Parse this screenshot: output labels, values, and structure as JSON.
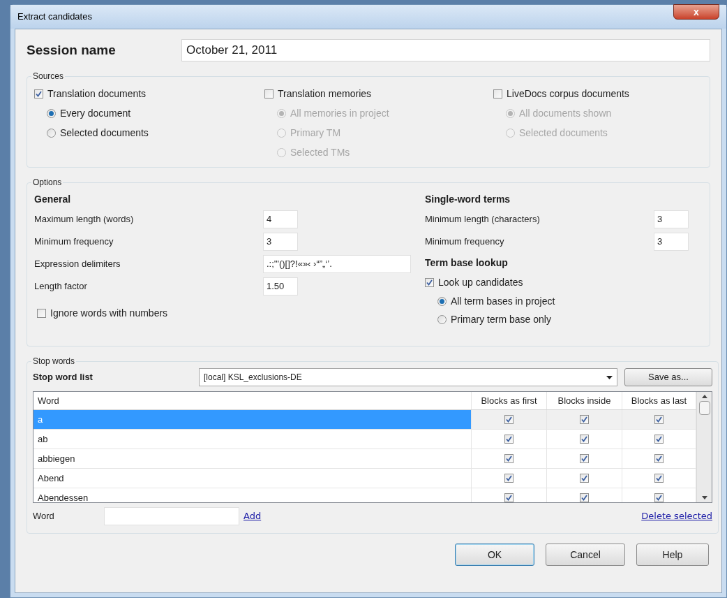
{
  "window": {
    "title": "Extract candidates",
    "close": "x"
  },
  "session": {
    "label": "Session name",
    "value": "October 21, 2011"
  },
  "sources": {
    "title": "Sources",
    "columns": [
      {
        "label": "Translation documents",
        "checked": true,
        "disabled": false,
        "options": [
          {
            "label": "Every document",
            "selected": true
          },
          {
            "label": "Selected documents",
            "selected": false
          }
        ]
      },
      {
        "label": "Translation memories",
        "checked": false,
        "disabled": true,
        "options": [
          {
            "label": "All memories in project",
            "selected": true
          },
          {
            "label": "Primary TM",
            "selected": false
          },
          {
            "label": "Selected TMs",
            "selected": false
          }
        ]
      },
      {
        "label": "LiveDocs corpus documents",
        "checked": false,
        "disabled": true,
        "options": [
          {
            "label": "All documents shown",
            "selected": true
          },
          {
            "label": "Selected documents",
            "selected": false
          }
        ]
      }
    ]
  },
  "options": {
    "title": "Options",
    "general": {
      "heading": "General",
      "fields": [
        {
          "label": "Maximum length (words)",
          "value": "4"
        },
        {
          "label": "Minimum frequency",
          "value": "3"
        },
        {
          "label": "Expression delimiters",
          "value": ".:;'\"()[]?!«»‹ ›“”„‘’."
        },
        {
          "label": "Length factor",
          "value": "1.50"
        }
      ],
      "ignore_numbers": {
        "label": "Ignore words with numbers",
        "checked": false
      }
    },
    "single_word": {
      "heading": "Single-word terms",
      "fields": [
        {
          "label": "Minimum length (characters)",
          "value": "3"
        },
        {
          "label": "Minimum frequency",
          "value": "3"
        }
      ]
    },
    "termbase": {
      "heading": "Term base lookup",
      "lookup": {
        "label": "Look up candidates",
        "checked": true
      },
      "options": [
        {
          "label": "All term bases in project",
          "selected": true
        },
        {
          "label": "Primary term base only",
          "selected": false
        }
      ]
    }
  },
  "stop_words": {
    "title": "Stop words",
    "list_label": "Stop word list",
    "list_value": "[local] KSL_exclusions-DE",
    "save_as": "Save as...",
    "columns": [
      "Word",
      "Blocks as first",
      "Blocks inside",
      "Blocks as last"
    ],
    "rows": [
      {
        "word": "a",
        "selected": true,
        "first": true,
        "inside": true,
        "last": true
      },
      {
        "word": "ab",
        "selected": false,
        "first": true,
        "inside": true,
        "last": true
      },
      {
        "word": "abbiegen",
        "selected": false,
        "first": true,
        "inside": true,
        "last": true
      },
      {
        "word": "Abend",
        "selected": false,
        "first": true,
        "inside": true,
        "last": true
      },
      {
        "word": "Abendessen",
        "selected": false,
        "first": true,
        "inside": true,
        "last": true
      }
    ],
    "word_label": "Word",
    "add": "Add",
    "delete": "Delete selected"
  },
  "buttons": [
    "OK",
    "Cancel",
    "Help"
  ]
}
